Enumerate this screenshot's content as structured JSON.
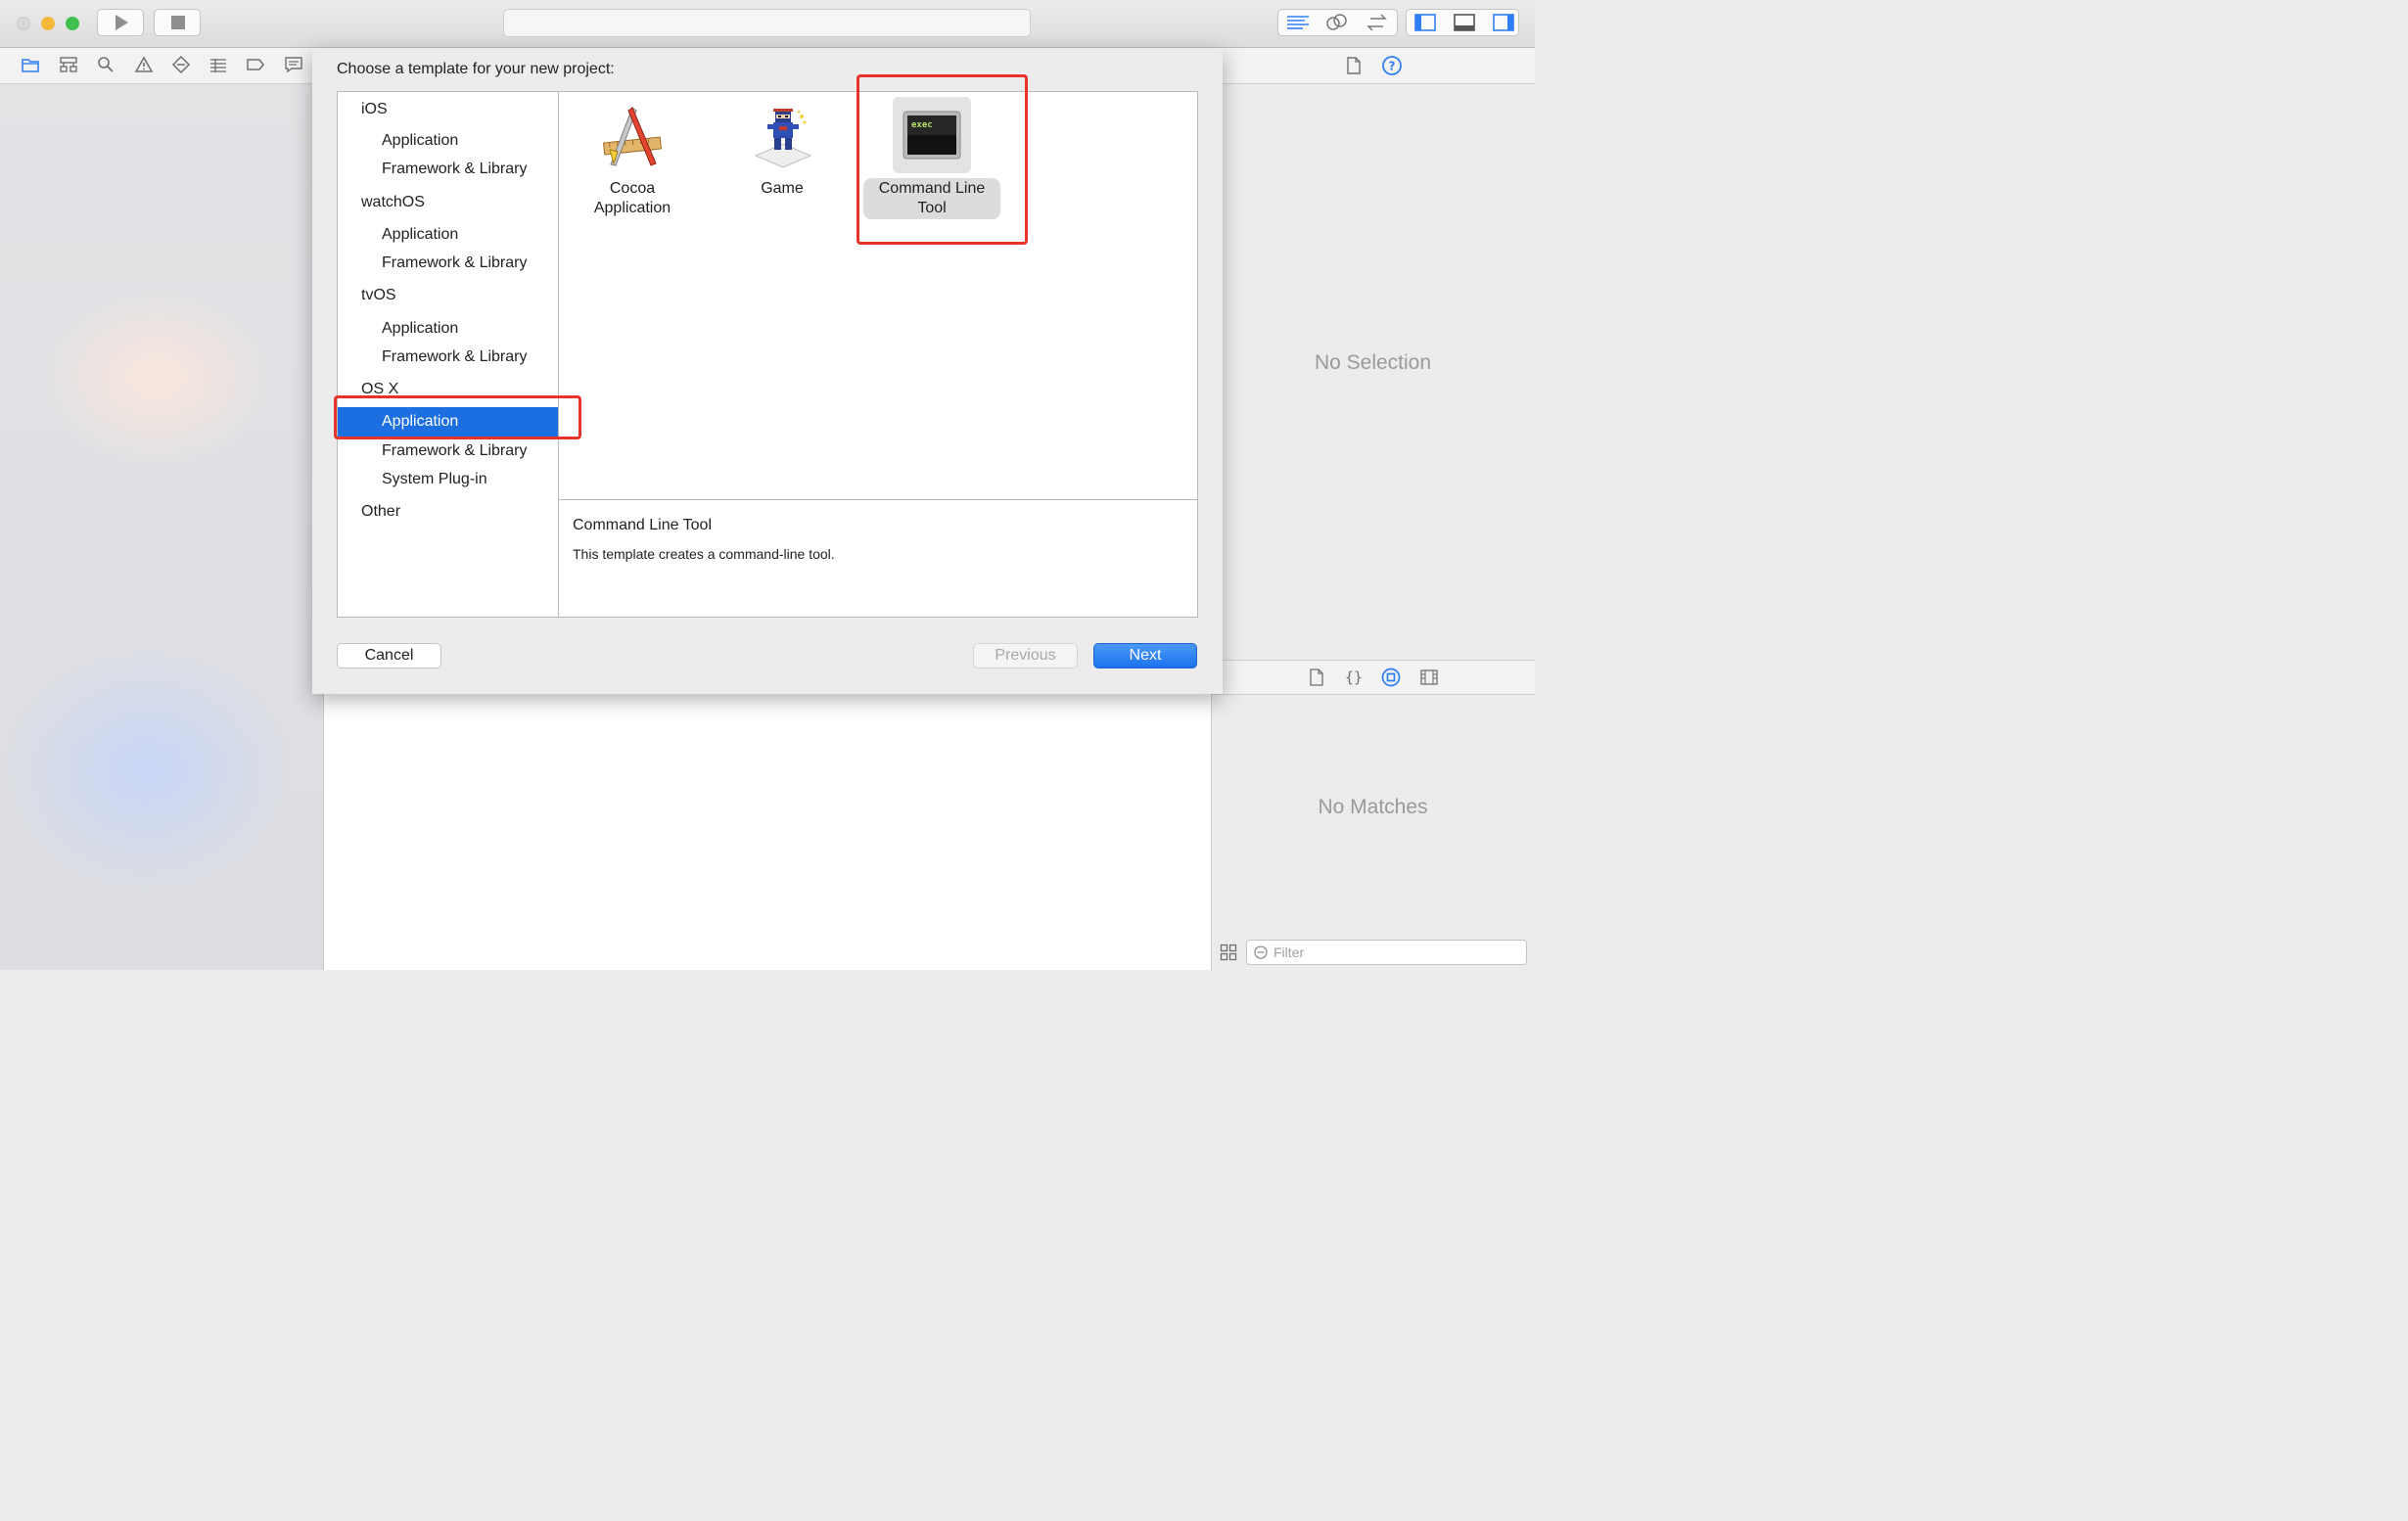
{
  "window": {
    "traffic_lights": {
      "close": "#d9d9d9",
      "minimize": "#f5b93a",
      "zoom": "#3fc04d"
    },
    "toolbar_buttons": [
      "run-button",
      "stop-button",
      "standard-editor-icon",
      "assistant-editor-icon",
      "version-editor-icon",
      "navigator-toggle-icon",
      "debug-area-toggle-icon",
      "utilities-toggle-icon"
    ],
    "accent": "#2f7ff2"
  },
  "navigator": {
    "icons": [
      "folder-icon",
      "hierarchy-icon",
      "search-icon",
      "warning-icon",
      "test-diamond-icon",
      "debug-list-icon",
      "breakpoint-icon",
      "report-icon"
    ]
  },
  "inspector": {
    "no_selection": "No Selection",
    "no_matches": "No Matches",
    "filter_placeholder": "Filter",
    "top_icons": [
      "file-inspector-icon",
      "quick-help-icon"
    ],
    "library_icons": [
      "file-template-icon",
      "code-snippet-icon",
      "object-library-icon",
      "media-library-icon"
    ]
  },
  "sheet": {
    "title": "Choose a template for your new project:",
    "categories": [
      {
        "name": "iOS",
        "items": [
          "Application",
          "Framework & Library"
        ]
      },
      {
        "name": "watchOS",
        "items": [
          "Application",
          "Framework & Library"
        ]
      },
      {
        "name": "tvOS",
        "items": [
          "Application",
          "Framework & Library"
        ]
      },
      {
        "name": "OS X",
        "items": [
          "Application",
          "Framework & Library",
          "System Plug-in"
        ]
      },
      {
        "name": "Other",
        "items": []
      }
    ],
    "selected_category": "OS X > Application",
    "templates": [
      {
        "label_line1": "Cocoa",
        "label_line2": "Application",
        "icon": "cocoa-app-icon"
      },
      {
        "label_line1": "Game",
        "label_line2": "",
        "icon": "game-ninja-icon"
      },
      {
        "label_line1": "Command Line",
        "label_line2": "Tool",
        "icon": "terminal-exec-icon",
        "icon_text": "exec"
      }
    ],
    "selected_template": "Command Line Tool",
    "description": {
      "title": "Command Line Tool",
      "text": "This template creates a command-line tool."
    },
    "buttons": {
      "cancel": "Cancel",
      "previous": "Previous",
      "next": "Next"
    }
  },
  "annotation_color": "#e8332b",
  "selection_color": "#1b6fe0"
}
